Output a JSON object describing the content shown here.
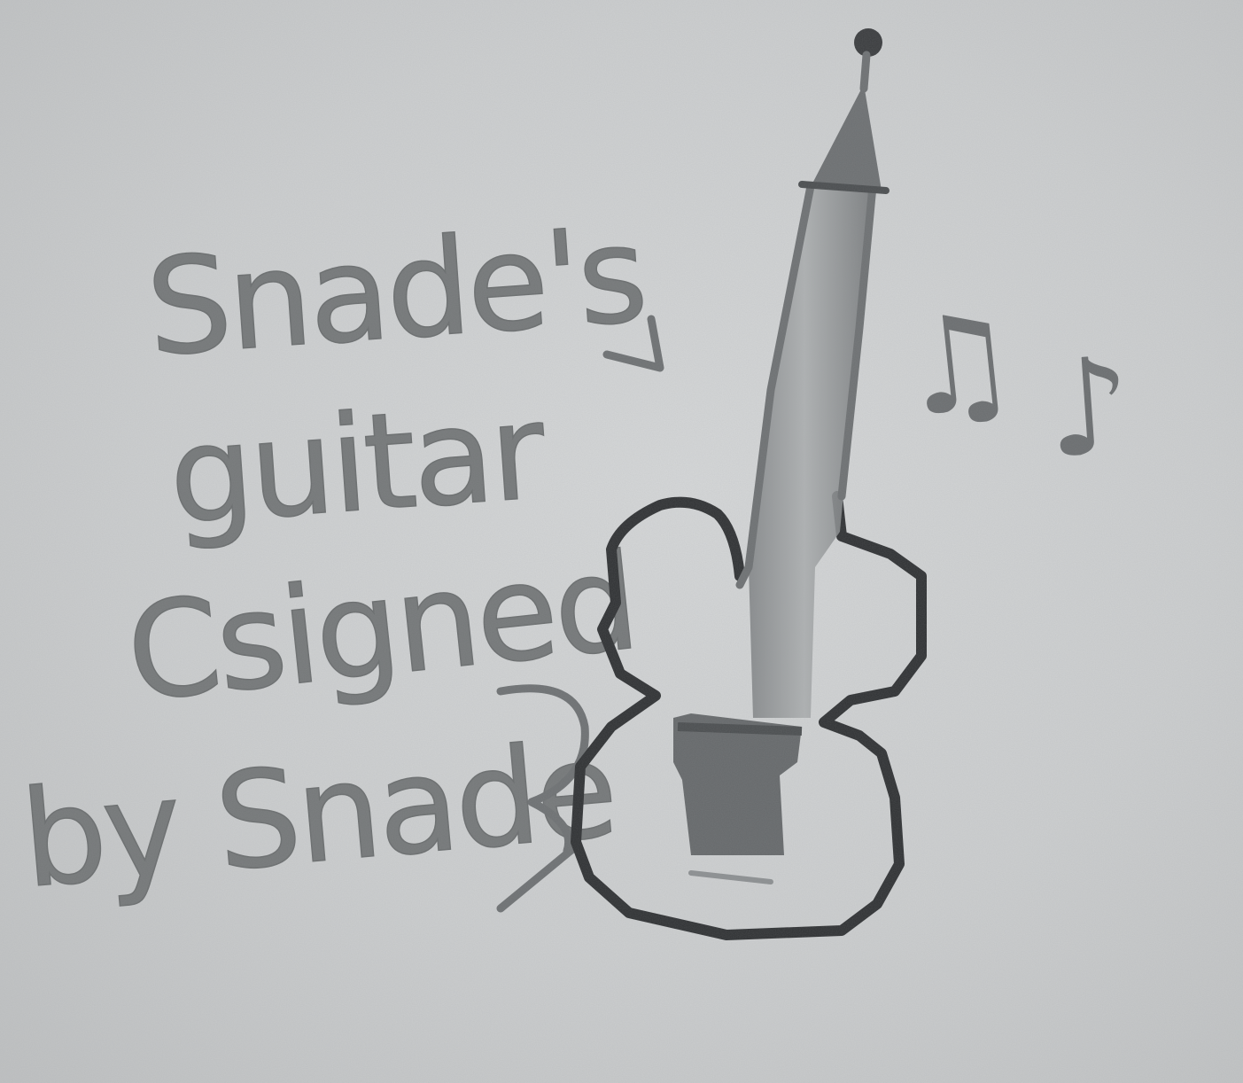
{
  "drawing": {
    "caption_lines": [
      "Snade's",
      "guitar",
      "Csigned",
      "by Snade"
    ],
    "arrow_icon": "arrow-pointing-icon",
    "guitar_icon": "guitar-icon",
    "notes_icons": [
      "beamed-eighth-notes-icon",
      "eighth-note-icon"
    ],
    "signature_mark": "signature-scribble-icon"
  },
  "colors": {
    "paper": "#c9cbcc",
    "pencil_dark": "#2f3133",
    "pencil_light": "#757879"
  }
}
